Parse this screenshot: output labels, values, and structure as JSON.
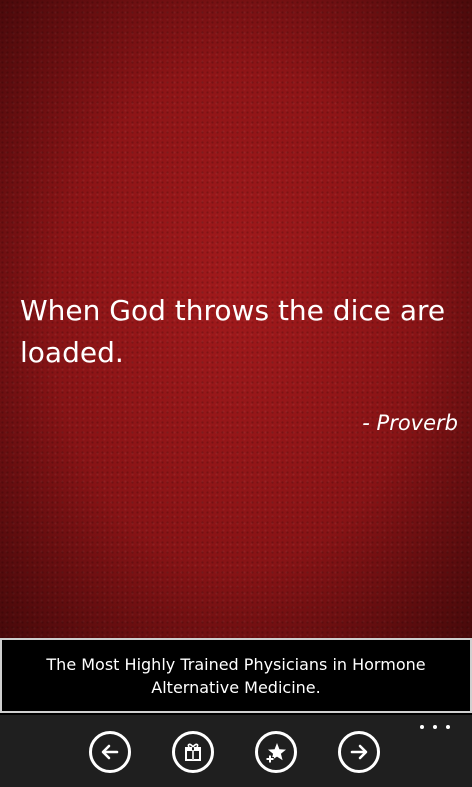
{
  "quote": {
    "text": "When God throws the dice are loaded.",
    "author": "- Proverb"
  },
  "ad": {
    "text": "The Most Highly Trained Physicians in Hormone Alternative Medicine."
  },
  "app_bar": {
    "buttons": [
      {
        "icon": "arrow-left-icon"
      },
      {
        "icon": "gift-icon"
      },
      {
        "icon": "star-add-icon"
      },
      {
        "icon": "arrow-right-icon"
      }
    ],
    "more_icon": "ellipsis-icon"
  },
  "colors": {
    "background_red": "#8e1517",
    "text": "#ffffff",
    "app_bar": "#1f1f1f",
    "ad_border": "#cfcfcf"
  }
}
